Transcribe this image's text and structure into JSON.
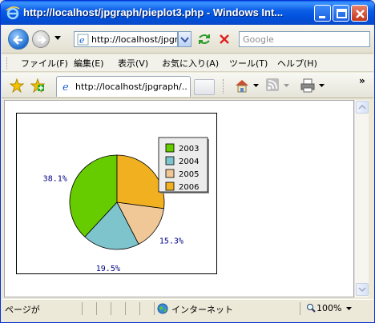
{
  "window": {
    "title": "http://localhost/jpgraph/pieplot3.php - Windows Int..."
  },
  "navbar": {
    "address": "http://localhost/jpgr",
    "search_placeholder": "Google"
  },
  "menu": {
    "items": [
      "ファイル(F)",
      "編集(E)",
      "表示(V)",
      "お気に入り(A)",
      "ツール(T)",
      "ヘルプ(H)"
    ]
  },
  "tab": {
    "title": "http://localhost/jpgraph/..."
  },
  "chart_data": {
    "type": "pie",
    "categories": [
      "2003",
      "2004",
      "2005",
      "2006"
    ],
    "values": [
      38.1,
      19.5,
      15.3,
      27.1
    ],
    "labels": [
      "38.1%",
      "19.5%",
      "15.3%",
      ""
    ],
    "colors": [
      "#66cc00",
      "#7ec4cc",
      "#f0c898",
      "#f0b020"
    ],
    "legend_position": "top-right",
    "start_angle_deg": 90,
    "direction": "counterclockwise"
  },
  "statusbar": {
    "text": "ページが",
    "zone": "インターネット",
    "zoom": "100%"
  },
  "colors": {
    "titlebar": "#0050dc",
    "chart_label": "#000080"
  }
}
